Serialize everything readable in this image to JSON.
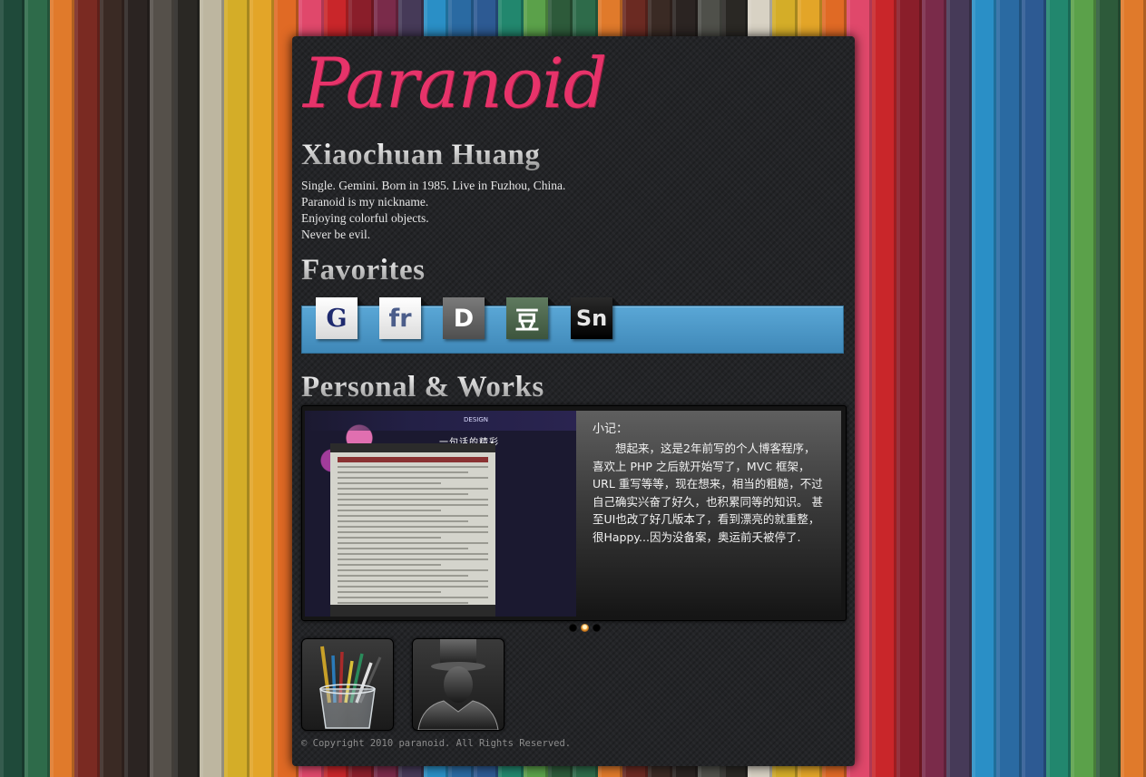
{
  "background": {
    "stripe_colors": [
      "#1f4a3a",
      "#2e6b4a",
      "#e07a2b",
      "#7a2a22",
      "#3a2a24",
      "#2b2422",
      "#55504a",
      "#2a2824",
      "#bdb6a0",
      "#d4ad28",
      "#e3a528",
      "#e06a25",
      "#e0486b",
      "#c9262a",
      "#8a1e2a",
      "#7a2b4a",
      "#463a58",
      "#2a8fc6",
      "#2a6aa2",
      "#2d5a93",
      "#22876e",
      "#5ba14a",
      "#2d5a3a",
      "#2e6b4a",
      "#e07a2b",
      "#6b2a22",
      "#3a2a24",
      "#2b2422",
      "#4f504a",
      "#2a2824",
      "#d8d2c4",
      "#d4ad28",
      "#e3a528",
      "#e06a25",
      "#e0486b",
      "#c9262a",
      "#8a1e2a",
      "#7a2b4a",
      "#463a58",
      "#2a8fc6",
      "#2a6aa2",
      "#2d5a93",
      "#22876e",
      "#5ba14a",
      "#2d5a3a",
      "#e07a2b"
    ]
  },
  "header": {
    "logo_text": "Paranoid"
  },
  "profile": {
    "name": "Xiaochuan Huang",
    "bio": [
      "Single. Gemini. Born in 1985. Live in Fuzhou, China.",
      "Paranoid is my nickname.",
      "Enjoying colorful objects.",
      "Never be evil."
    ]
  },
  "favorites": {
    "heading": "Favorites",
    "items": [
      {
        "label": "G",
        "icon": "google-icon"
      },
      {
        "label": "fr",
        "icon": "flickr-icon"
      },
      {
        "label": "D",
        "icon": "delicious-icon"
      },
      {
        "label": "豆",
        "icon": "douban-icon"
      },
      {
        "label": "Sn",
        "icon": "snipt-icon"
      }
    ],
    "bar_color": "#4a97c9"
  },
  "works": {
    "heading": "Personal & Works",
    "screenshot": {
      "design_label": "DESIGN",
      "slogan": "一句话的精彩"
    },
    "note_title": "小记：",
    "note_body": "想起来，这是2年前写的个人博客程序，喜欢上 PHP 之后就开始写了，MVC 框架，URL 重写等等，现在想来，相当的粗糙，不过自己确实兴奋了好久，也积累同等的知识。 甚至UI也改了好几版本了，看到漂亮的就重整，很Happy...因为没备案，奥运前夭被停了.",
    "slider_dots": 3,
    "active_dot": 1,
    "thumbnails": [
      {
        "icon": "pen-cup-icon"
      },
      {
        "icon": "spy-avatar-icon"
      }
    ]
  },
  "footer": {
    "copyright": "© Copyright 2010 paranoid. All Rights Reserved."
  }
}
